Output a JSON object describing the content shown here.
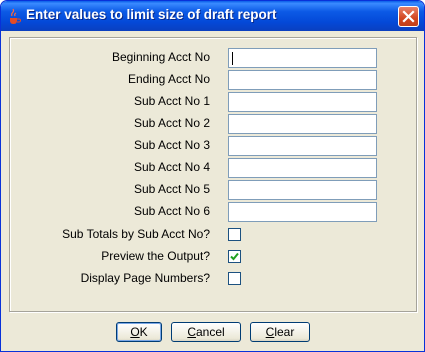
{
  "window": {
    "title": "Enter values to limit size of draft report"
  },
  "fields": [
    {
      "label": "Beginning Acct No",
      "value": ""
    },
    {
      "label": "Ending Acct No",
      "value": ""
    },
    {
      "label": "Sub Acct No 1",
      "value": ""
    },
    {
      "label": "Sub Acct No 2",
      "value": ""
    },
    {
      "label": "Sub Acct No 3",
      "value": ""
    },
    {
      "label": "Sub Acct No 4",
      "value": ""
    },
    {
      "label": "Sub Acct No 5",
      "value": ""
    },
    {
      "label": "Sub Acct No 6",
      "value": ""
    }
  ],
  "options": [
    {
      "label": "Sub Totals by Sub Acct No?",
      "checked": false
    },
    {
      "label": "Preview the Output?",
      "checked": true
    },
    {
      "label": "Display Page Numbers?",
      "checked": false
    }
  ],
  "buttons": {
    "ok": {
      "first": "O",
      "rest": "K"
    },
    "cancel": {
      "first": "C",
      "rest": "ancel"
    },
    "clear": {
      "first": "C",
      "rest": "lear"
    }
  },
  "colors": {
    "titlebar": "#0449d8",
    "close": "#d2461f",
    "dialog_bg": "#ece9d8",
    "field_border": "#7f9db9",
    "checkmark": "#21a121"
  },
  "icons": {
    "app": "java-cup-icon",
    "close": "close-icon",
    "check": "checkmark-icon"
  }
}
